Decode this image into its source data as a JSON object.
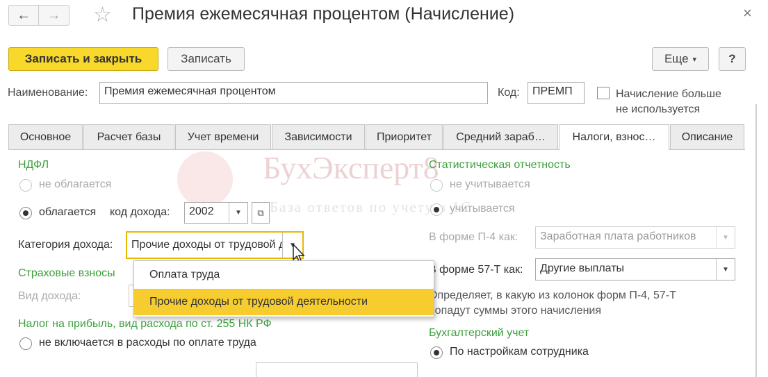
{
  "window": {
    "title": "Премия ежемесячная процентом (Начисление)",
    "close_glyph": "×",
    "back_glyph": "←",
    "forward_glyph": "→",
    "star_glyph": "☆"
  },
  "toolbar": {
    "save_close_label": "Записать и закрыть",
    "save_label": "Записать",
    "more_label": "Еще",
    "more_caret": "▾",
    "help_label": "?"
  },
  "form": {
    "name_label": "Наименование:",
    "name_value": "Премия ежемесячная процентом",
    "code_label": "Код:",
    "code_value": "ПРЕМП",
    "unused_label_line1": "Начисление больше",
    "unused_label_line2": "не используется"
  },
  "tabs": [
    {
      "label": "Основное"
    },
    {
      "label": "Расчет базы"
    },
    {
      "label": "Учет времени"
    },
    {
      "label": "Зависимости"
    },
    {
      "label": "Приоритет"
    },
    {
      "label": "Средний зараб…"
    },
    {
      "label": "Налоги, взнос…"
    },
    {
      "label": "Описание"
    }
  ],
  "ndfl": {
    "header": "НДФЛ",
    "not_taxed": "не облагается",
    "taxed": "облагается",
    "income_code_label": "код дохода:",
    "income_code_value": "2002",
    "income_category_label": "Категория дохода:",
    "income_category_value": "Прочие доходы от трудовой деятельности"
  },
  "insurance": {
    "header": "Страховые взносы",
    "income_type_label": "Вид дохода:"
  },
  "profit_tax": {
    "header": "Налог на прибыль, вид расхода по ст. 255 НК РФ",
    "not_included": "не включается в расходы по оплате труда"
  },
  "dropdown_menu": {
    "items": [
      "Оплата труда",
      "Прочие доходы от трудовой деятельности"
    ],
    "selected_index": 1
  },
  "stats": {
    "header": "Статистическая отчетность",
    "not_counted": "не учитывается",
    "counted": "учитывается",
    "p4_label": "В форме П-4 как:",
    "p4_value": "Заработная плата работников",
    "f57_label": "В форме 57-Т как:",
    "f57_value": "Другие выплаты",
    "note_line1": "Определяет, в какую из колонок форм П-4, 57-Т",
    "note_line2": "попадут суммы этого начисления"
  },
  "accounting": {
    "header": "Бухгалтерский учет",
    "by_employee": "По настройкам сотрудника"
  },
  "watermark": {
    "brand": "БухЭксперт8",
    "slogan": "База ответов по учету в 1С"
  },
  "colors": {
    "accent_yellow": "#f7d82b",
    "section_green": "#3ca03c",
    "focus_border": "#e8b800"
  }
}
